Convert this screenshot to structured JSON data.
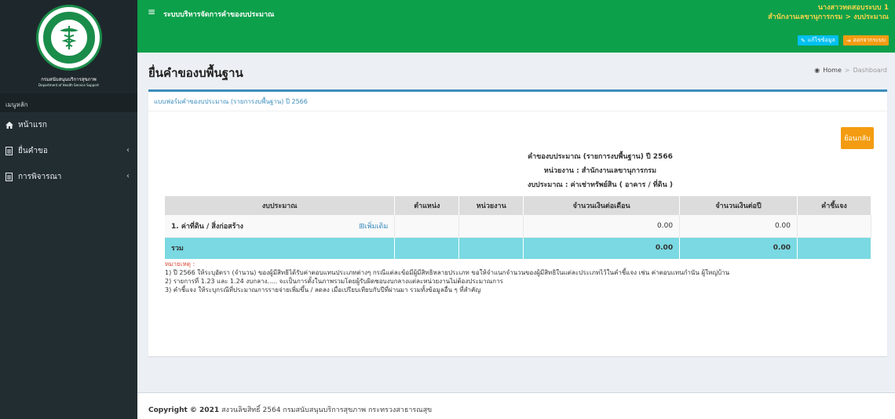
{
  "header": {
    "app_title": "ระบบบริหารจัดการคำของบประมาณ",
    "user_name": "นางสาวทดสอบระบบ 1",
    "user_org": "สำนักงานเลขานุการกรม > งบประมาณ",
    "edit_profile_label": "แก้ไขข้อมูล",
    "logout_label": "ออกจากระบบ"
  },
  "sidebar": {
    "logo_org_th": "กรมสนับสนุนบริการสุขภาพ",
    "logo_org_en": "Department of Health Service Support",
    "logo_seal_text": "กระทรวงสาธารณสุข MINISTRY OF PUBLIC HEALTH",
    "menu_header": "เมนูหลัก",
    "items": [
      {
        "label": "หน้าแรก",
        "icon": "home-icon"
      },
      {
        "label": "ยื่นคำขอ",
        "icon": "file-icon"
      },
      {
        "label": "การพิจารณา",
        "icon": "file-icon"
      }
    ]
  },
  "content": {
    "page_title": "ยื่นคำของบพื้นฐาน",
    "breadcrumb": {
      "home": "Home",
      "current": "Dashboard"
    },
    "box_title": "แบบฟอร์มคำของบประมาณ (รายการงบพื้นฐาน) ปี 2566",
    "back_label": "ย้อนกลับ",
    "report_title": "คำของบประมาณ (รายการงบพื้นฐาน) ปี 2566",
    "report_unit": "หน่วยงาน : สำนักงานเลขานุการกรม",
    "report_budget": "งบประมาณ : ค่าเช่าทรัพย์สิน ( อาคาร / ที่ดิน )"
  },
  "table": {
    "headers": [
      "งบประมาณ",
      "ตำแหน่ง",
      "หน่วยงาน",
      "จำนวนเงินต่อเดือน",
      "จำนวนเงินต่อปี",
      "คำชี้แจง"
    ],
    "row": {
      "item": "1. ค่าที่ดิน / สิ่งก่อสร้าง",
      "add_label": "เพิ่มเติม",
      "monthly": "0.00",
      "yearly": "0.00"
    },
    "total": {
      "label": "รวม",
      "monthly": "0.00",
      "yearly": "0.00"
    }
  },
  "notes": {
    "label": "หมายเหตุ :",
    "lines": [
      "1) ปี 2566 ให้ระบุอัตรา (จำนวน) ของผู้มีสิทธิได้รับค่าตอบแทนประเภทต่างๆ กรณีแต่ละข้อมีผู้มีสิทธิหลายประเภท ขอให้จำแนกจำนวนของผู้มีสิทธิในแต่ละประเภทไว้ในคำชี้แจง เช่น ค่าตอบแทนกำนัน ผู้ใหญ่บ้าน",
      "2) รายการที่ 1.23 และ 1.24 งบกลาง..... จะเป็นการตั้งในภาพรวมโดยผู้รับผิดชอบงบกลางแต่ละหน่วยงานไม่ต้องประมาณการ",
      "3) คำชี้แจง ให้ระบุกรณีที่ประมาณการรายจ่ายเพิ่มขึ้น / ลดลง เมื่อเปรียบเทียบกับปีที่ผ่านมา รวมทั้งข้อมูลอื่น ๆ ที่สำคัญ"
    ]
  },
  "footer": {
    "copyright": "Copyright © 2021",
    "rest": "สงวนลิขสิทธิ์ 2564 กรมสนับสนุนบริการสุขภาพ กระทรวงสาธารณสุข"
  },
  "colors": {
    "header_green": "#0da04b",
    "sidebar_dark": "#222d32",
    "total_row": "#7ad9e2",
    "back_button": "#f39c12",
    "link_blue": "#3c8dbc"
  }
}
